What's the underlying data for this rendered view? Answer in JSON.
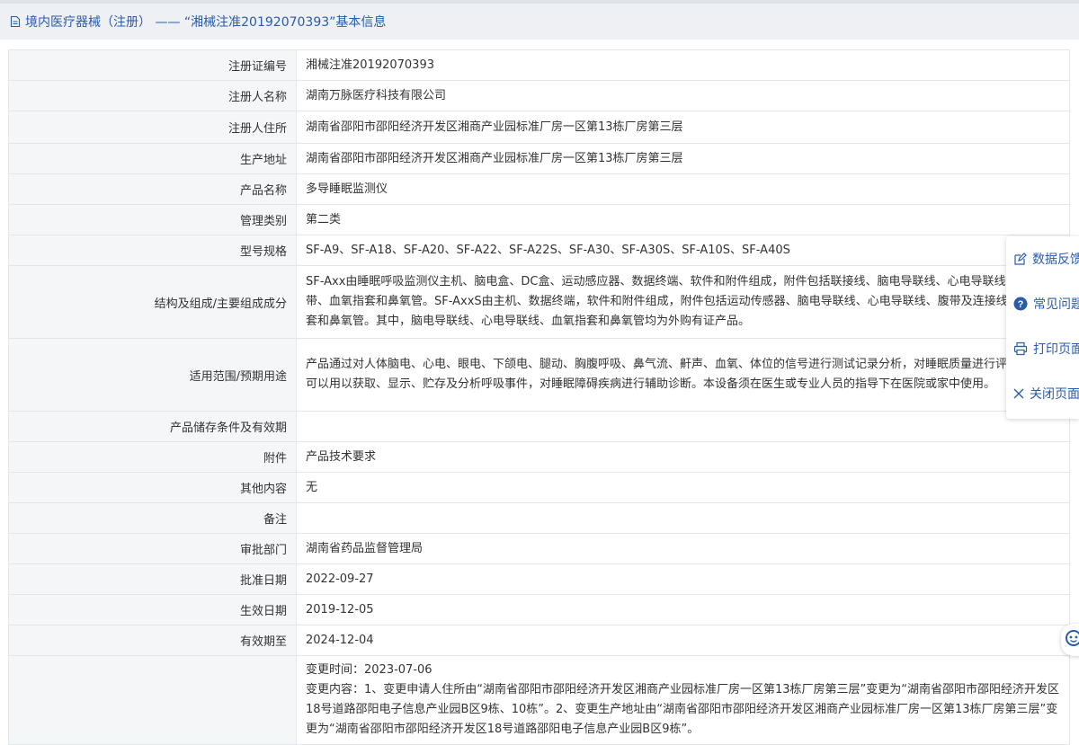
{
  "header": {
    "title": "境内医疗器械（注册） —— “湘械注准20192070393”基本信息"
  },
  "rows": [
    {
      "label": "注册证编号",
      "value": "湘械注准20192070393"
    },
    {
      "label": "注册人名称",
      "value": "湖南万脉医疗科技有限公司"
    },
    {
      "label": "注册人住所",
      "value": "湖南省邵阳市邵阳经济开发区湘商产业园标准厂房一区第13栋厂房第三层"
    },
    {
      "label": "生产地址",
      "value": "湖南省邵阳市邵阳经济开发区湘商产业园标准厂房一区第13栋厂房第三层"
    },
    {
      "label": "产品名称",
      "value": "多导睡眠监测仪"
    },
    {
      "label": "管理类别",
      "value": "第二类"
    },
    {
      "label": "型号规格",
      "value": "SF-A9、SF-A18、SF-A20、SF-A22、SF-A22S、SF-A30、SF-A30S、SF-A10S、SF-A40S"
    },
    {
      "label": "结构及组成/主要组成成分",
      "value": "SF-Axx由睡眠呼吸监测仪主机、脑电盒、DC盒、运动感应器、数据终端、软件和附件组成，附件包括联接线、脑电导联线、心电导联线、固定带、血氧指套和鼻氧管。SF-AxxS由主机、数据终端，软件和附件组成，附件包括运动传感器、脑电导联线、心电导联线、腹带及连接线、血氧指套和鼻氧管。其中，脑电导联线、心电导联线、血氧指套和鼻氧管均为外购有证产品。"
    },
    {
      "label": "适用范围/预期用途",
      "value": "产品通过对人体脑电、心电、眼电、下颌电、腿动、胸腹呼吸、鼻气流、鼾声、血氧、体位的信号进行测试记录分析，对睡眠质量进行评估。产品可以用以获取、显示、贮存及分析呼吸事件，对睡眠障碍疾病进行辅助诊断。本设备须在医生或专业人员的指导下在医院或家中使用。"
    },
    {
      "label": "产品储存条件及有效期",
      "value": ""
    },
    {
      "label": "附件",
      "value": "产品技术要求"
    },
    {
      "label": "其他内容",
      "value": "无"
    },
    {
      "label": "备注",
      "value": ""
    },
    {
      "label": "审批部门",
      "value": "湖南省药品监督管理局"
    },
    {
      "label": "批准日期",
      "value": "2022-09-27"
    },
    {
      "label": "生效日期",
      "value": "2019-12-05"
    },
    {
      "label": "有效期至",
      "value": "2024-12-04"
    }
  ],
  "change": {
    "time": "变更时间：2023-07-06",
    "content": "变更内容：1、变更申请人住所由“湖南省邵阳市邵阳经济开发区湘商产业园标准厂房一区第13栋厂房第三层”变更为“湖南省邵阳市邵阳经济开发区18号道路邵阳电子信息产业园B区9栋、10栋”。2、变更生产地址由“湖南省邵阳市邵阳经济开发区湘商产业园标准厂房一区第13栋厂房第三层”变更为“湖南省邵阳市邵阳经济开发区18号道路邵阳电子信息产业园B区9栋”。"
  },
  "side_menu": {
    "feedback": "数据反馈",
    "faq": "常见问题",
    "print": "打印页面",
    "close": "关闭页面"
  },
  "colors": {
    "link": "#2a5caa",
    "label_bg": "#f5f6f8",
    "border": "#e3e6ea"
  }
}
